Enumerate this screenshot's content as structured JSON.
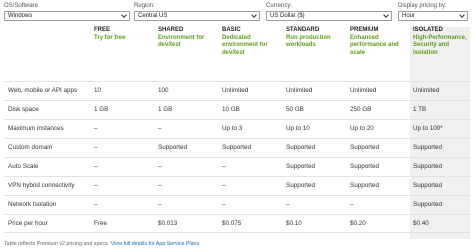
{
  "filters": {
    "os": {
      "label": "OS/Software",
      "value": "Windows"
    },
    "region": {
      "label": "Region:",
      "value": "Central US"
    },
    "currency": {
      "label": "Currency:",
      "value": "US Dollar ($)"
    },
    "display": {
      "label": "Display pricing by:",
      "value": "Hour"
    }
  },
  "tiers": [
    {
      "name": "FREE",
      "desc": "Try for free"
    },
    {
      "name": "SHARED",
      "desc": "Environment for dev/test"
    },
    {
      "name": "BASIC",
      "desc": "Dedicated environment for dev/test"
    },
    {
      "name": "STANDARD",
      "desc": "Run production workloads"
    },
    {
      "name": "PREMIUM",
      "desc": "Enhanced performance and scale"
    },
    {
      "name": "ISOLATED",
      "desc": "High-Performance, Security and Isolation"
    }
  ],
  "rows": [
    {
      "label": "Web, mobile or API apps",
      "values": [
        "10",
        "100",
        "Unlimited",
        "Unlimited",
        "Unlimited",
        "Unlimited"
      ]
    },
    {
      "label": "Disk space",
      "values": [
        "1 GB",
        "1 GB",
        "10 GB",
        "50 GB",
        "250 GB",
        "1 TB"
      ]
    },
    {
      "label": "Maximum instances",
      "values": [
        "–",
        "–",
        "Up to 3",
        "Up to 10",
        "Up to 20",
        "Up to 100*"
      ]
    },
    {
      "label": "Custom domain",
      "values": [
        "–",
        "Supported",
        "Supported",
        "Supported",
        "Supported",
        "Supported"
      ]
    },
    {
      "label": "Auto Scale",
      "values": [
        "–",
        "–",
        "–",
        "Supported",
        "Supported",
        "Supported"
      ]
    },
    {
      "label": "VPN hybrid connectivity",
      "values": [
        "–",
        "–",
        "–",
        "Supported",
        "Supported",
        "Supported"
      ]
    },
    {
      "label": "Network Isolation",
      "values": [
        "–",
        "–",
        "–",
        "–",
        "–",
        "Supported"
      ]
    },
    {
      "label": "Price per hour",
      "values": [
        "Free",
        "$0.013",
        "$0.075",
        "$0.10",
        "$0.20",
        "$0.40"
      ]
    }
  ],
  "footnote": {
    "text": "Table reflects Premium v2 pricing and specs.",
    "link": "View full details for App Service Plans"
  }
}
